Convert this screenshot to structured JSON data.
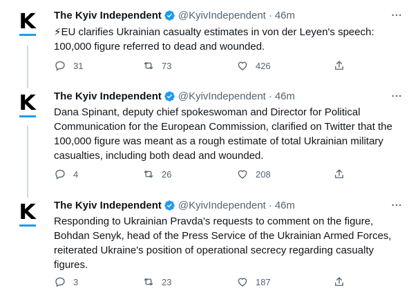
{
  "tweets": [
    {
      "display_name": "The Kyiv Independent",
      "handle": "@KyivIndependent",
      "separator": "·",
      "time": "46m",
      "avatar_letter": "K",
      "text": "⚡EU clarifies Ukrainian casualty estimates in von der Leyen's speech: 100,000 figure referred to dead and wounded.",
      "replies": "31",
      "retweets": "73",
      "likes": "426"
    },
    {
      "display_name": "The Kyiv Independent",
      "handle": "@KyivIndependent",
      "separator": "·",
      "time": "46m",
      "avatar_letter": "K",
      "text": "Dana Spinant, deputy chief spokeswoman and Director for Political Communication for the European Commission, clarified on Twitter that the 100,000 figure was meant as a rough estimate of total Ukrainian military casualties, including both dead and wounded.",
      "replies": "4",
      "retweets": "26",
      "likes": "208"
    },
    {
      "display_name": "The Kyiv Independent",
      "handle": "@KyivIndependent",
      "separator": "·",
      "time": "46m",
      "avatar_letter": "K",
      "text": "Responding to Ukrainian Pravda's requests to comment on the figure, Bohdan Senyk, head of the Press Service of the Ukrainian Armed Forces, reiterated Ukraine's position of operational secrecy regarding casualty figures.",
      "replies": "3",
      "retweets": "23",
      "likes": "187"
    }
  ],
  "colors": {
    "verified": "#1d9bf0",
    "secondary_text": "#536471",
    "thread_line": "#cfd9de",
    "logo_underline": "#1d9bf0"
  },
  "icons": [
    "verified-badge-icon",
    "more-icon",
    "reply-icon",
    "retweet-icon",
    "like-icon",
    "share-icon"
  ]
}
